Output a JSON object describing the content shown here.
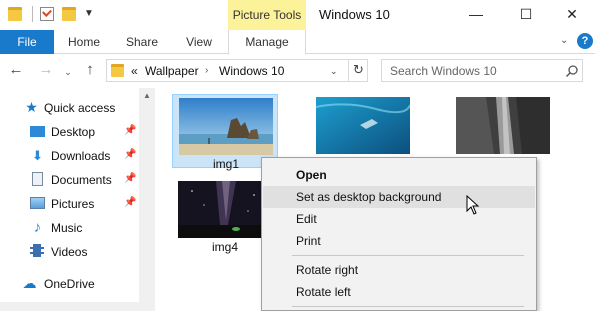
{
  "titlebar": {
    "window_title": "Windows 10",
    "contextual_tab": "Picture Tools",
    "minimize": "—",
    "maximize": "☐",
    "close": "✕"
  },
  "ribbon": {
    "tabs": [
      {
        "label": "File"
      },
      {
        "label": "Home"
      },
      {
        "label": "Share"
      },
      {
        "label": "View"
      },
      {
        "label": "Manage"
      }
    ],
    "help": "?"
  },
  "address": {
    "overflow": "«",
    "segments": [
      "Wallpaper",
      "Windows 10"
    ],
    "search_placeholder": "Search Windows 10"
  },
  "navpane": {
    "quick_access": "Quick access",
    "items": [
      {
        "label": "Desktop",
        "pinned": true
      },
      {
        "label": "Downloads",
        "pinned": true
      },
      {
        "label": "Documents",
        "pinned": true
      },
      {
        "label": "Pictures",
        "pinned": true
      },
      {
        "label": "Music",
        "pinned": false
      },
      {
        "label": "Videos",
        "pinned": false
      }
    ],
    "onedrive": "OneDrive"
  },
  "files": [
    {
      "label": "img1",
      "selected": true
    },
    {
      "label": "",
      "selected": false
    },
    {
      "label": "",
      "selected": false
    },
    {
      "label": "img4",
      "selected": false
    }
  ],
  "context_menu": {
    "items": [
      {
        "label": "Open",
        "bold": true
      },
      {
        "label": "Set as desktop background",
        "highlighted": true
      },
      {
        "label": "Edit"
      },
      {
        "label": "Print"
      },
      {
        "label": "Rotate right"
      },
      {
        "label": "Rotate left"
      }
    ]
  },
  "colors": {
    "accent": "#1979ca",
    "contextual_tab_bg": "#fbf29a",
    "selection_bg": "#cce4f7"
  }
}
